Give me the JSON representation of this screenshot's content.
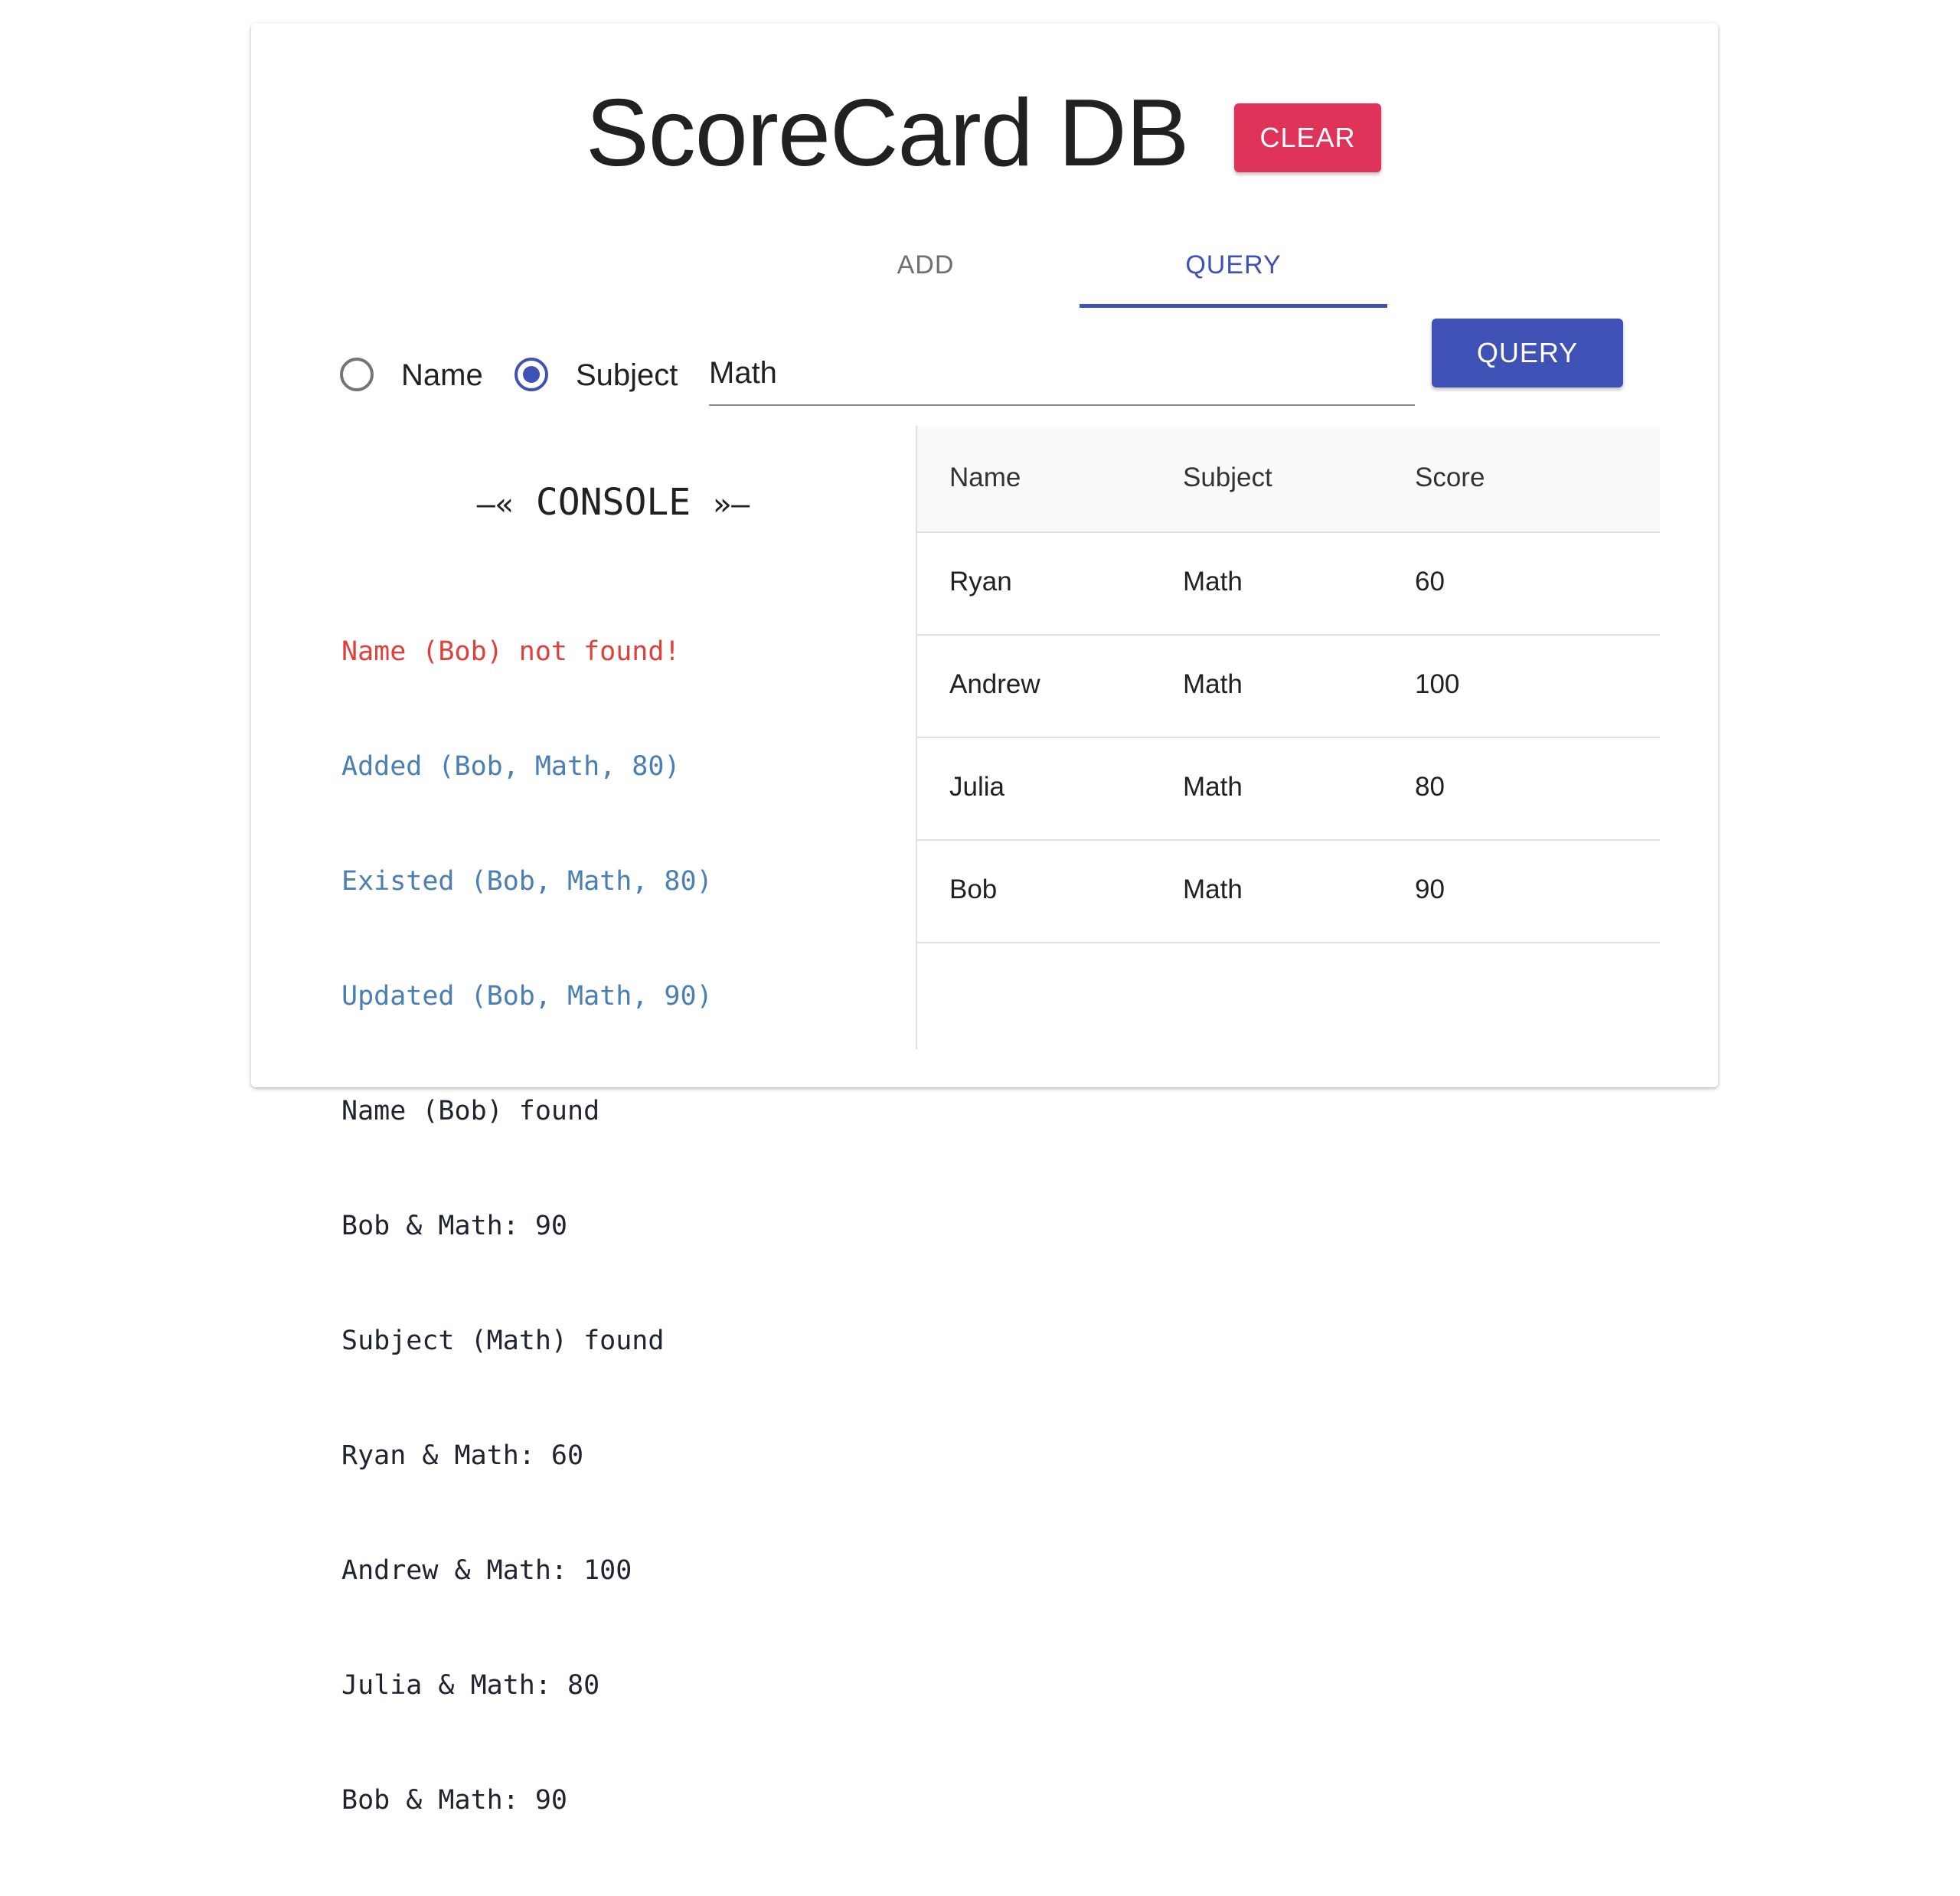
{
  "app": {
    "title": "ScoreCard DB",
    "clear_label": "CLEAR"
  },
  "tabs": [
    {
      "label": "ADD",
      "active": false
    },
    {
      "label": "QUERY",
      "active": true
    }
  ],
  "query_form": {
    "radio_options": [
      {
        "label": "Name",
        "selected": false
      },
      {
        "label": "Subject",
        "selected": true
      }
    ],
    "input_value": "Math",
    "submit_label": "QUERY"
  },
  "console": {
    "title": "CONSOLE",
    "left_deco": "—«",
    "right_deco": "»—",
    "lines": [
      {
        "text": "Name (Bob) not found!",
        "color": "#e0403a"
      },
      {
        "text": "Added (Bob, Math, 80)",
        "color": "#4a7fb5"
      },
      {
        "text": "Existed (Bob, Math, 80)",
        "color": "#4a7fb5"
      },
      {
        "text": "Updated (Bob, Math, 90)",
        "color": "#4a7fb5"
      },
      {
        "text": "Name (Bob) found",
        "color": "#1f2430"
      },
      {
        "text": "Bob & Math: 90",
        "color": "#1f2430"
      },
      {
        "text": "Subject (Math) found",
        "color": "#1f2430"
      },
      {
        "text": "Ryan & Math: 60",
        "color": "#1f2430"
      },
      {
        "text": "Andrew & Math: 100",
        "color": "#1f2430"
      },
      {
        "text": "Julia & Math: 80",
        "color": "#1f2430"
      },
      {
        "text": "Bob & Math: 90",
        "color": "#1f2430"
      }
    ]
  },
  "table": {
    "headers": [
      "Name",
      "Subject",
      "Score"
    ],
    "rows": [
      [
        "Ryan",
        "Math",
        "60"
      ],
      [
        "Andrew",
        "Math",
        "100"
      ],
      [
        "Julia",
        "Math",
        "80"
      ],
      [
        "Bob",
        "Math",
        "90"
      ]
    ]
  },
  "colors": {
    "accent": "#3f51b5",
    "clear": "#e0335a"
  }
}
